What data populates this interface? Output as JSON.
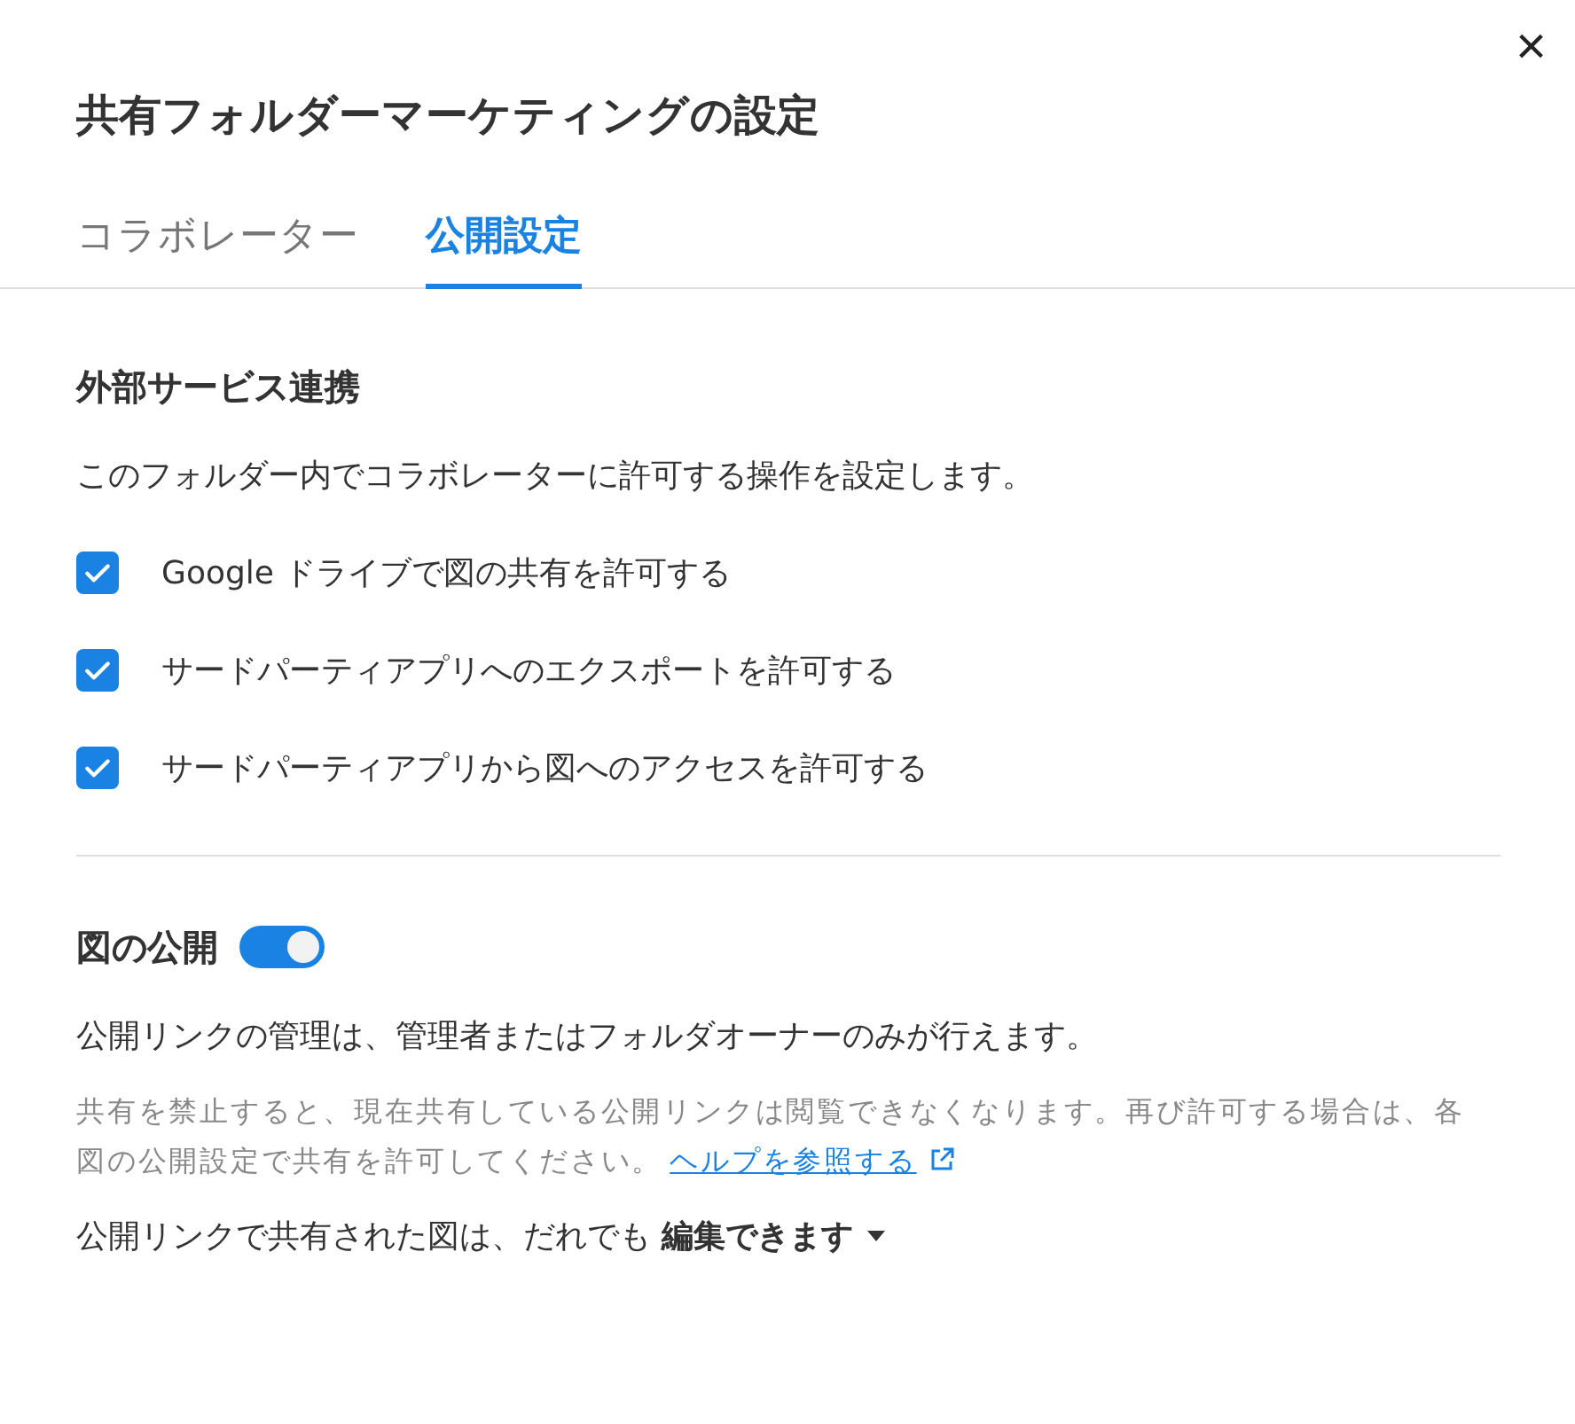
{
  "dialog": {
    "title": "共有フォルダーマーケティングの設定",
    "close": "×"
  },
  "tabs": [
    {
      "label": "コラボレーター",
      "selected": false
    },
    {
      "label": "公開設定",
      "selected": true
    }
  ],
  "integration": {
    "heading": "外部サービス連携",
    "description": "このフォルダー内でコラボレーターに許可する操作を設定します。",
    "options": [
      {
        "label": "Google ドライブで図の共有を許可する",
        "checked": true
      },
      {
        "label": "サードパーティアプリへのエクスポートを許可する",
        "checked": true
      },
      {
        "label": "サードパーティアプリから図へのアクセスを許可する",
        "checked": true
      }
    ]
  },
  "publishing": {
    "heading": "図の公開",
    "on": true,
    "note": "公開リンクの管理は、管理者またはフォルダオーナーのみが行えます。",
    "warning": "共有を禁止すると、現在共有している公開リンクは閲覧できなくなります。再び許可する場合は、各図の公開設定で共有を許可してください。",
    "help_link": "ヘルプを参照する",
    "access_text": "公開リンクで共有された図は、だれでも",
    "access_value": "編集できます"
  }
}
